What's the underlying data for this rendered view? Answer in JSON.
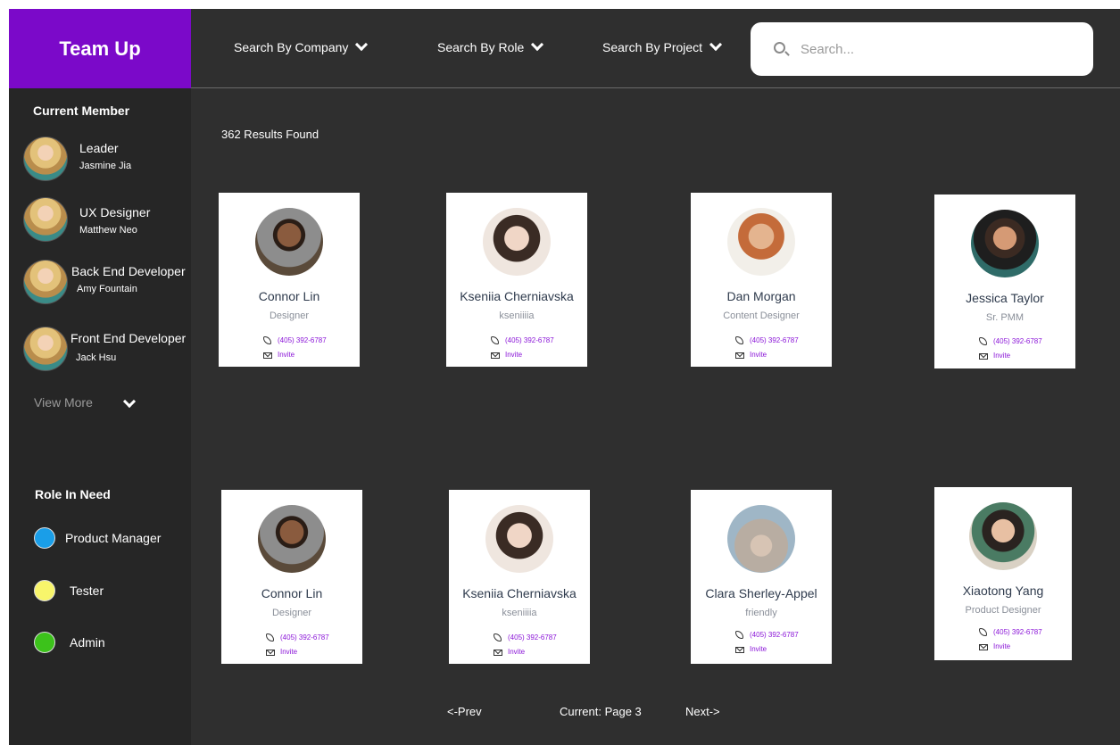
{
  "app": {
    "title": "Team Up"
  },
  "header": {
    "filters": [
      "Search By Company",
      "Search By Role",
      "Search By Project"
    ],
    "search_placeholder": "Search..."
  },
  "sidebar": {
    "current_member_title": "Current Member",
    "members": [
      {
        "role": "Leader",
        "name": "Jasmine Jia"
      },
      {
        "role": "UX Designer",
        "name": "Matthew Neo"
      },
      {
        "role": "Back End Developer",
        "name": "Amy Fountain"
      },
      {
        "role": "Front End Developer",
        "name": "Jack Hsu"
      }
    ],
    "view_more": "View More",
    "role_in_need_title": "Role In Need",
    "roles_needed": [
      {
        "label": "Product Manager",
        "color": "#1a9ee8"
      },
      {
        "label": "Tester",
        "color": "#f8f56b"
      },
      {
        "label": "Admin",
        "color": "#3cc21b"
      }
    ]
  },
  "results": {
    "text": "362 Results Found"
  },
  "cards": [
    {
      "name": "Connor Lin",
      "sub": "Designer",
      "phone": "(405) 392-6787",
      "invite": "Invite"
    },
    {
      "name": "Kseniia Cherniavska",
      "sub": "kseniiiia",
      "phone": "(405) 392-6787",
      "invite": "Invite"
    },
    {
      "name": "Dan Morgan",
      "sub": "Content Designer",
      "phone": "(405) 392-6787",
      "invite": "Invite"
    },
    {
      "name": "Jessica Taylor",
      "sub": "Sr. PMM",
      "phone": "(405) 392-6787",
      "invite": "Invite"
    },
    {
      "name": "Connor Lin",
      "sub": "Designer",
      "phone": "(405) 392-6787",
      "invite": "Invite"
    },
    {
      "name": "Kseniia Cherniavska",
      "sub": "kseniiiia",
      "phone": "(405) 392-6787",
      "invite": "Invite"
    },
    {
      "name": "Clara Sherley-Appel",
      "sub": "friendly",
      "phone": "(405) 392-6787",
      "invite": "Invite"
    },
    {
      "name": "Xiaotong Yang",
      "sub": "Product Designer",
      "phone": "(405) 392-6787",
      "invite": "Invite"
    }
  ],
  "pagination": {
    "prev": "<-Prev",
    "current": "Current: Page 3",
    "next": "Next->"
  }
}
